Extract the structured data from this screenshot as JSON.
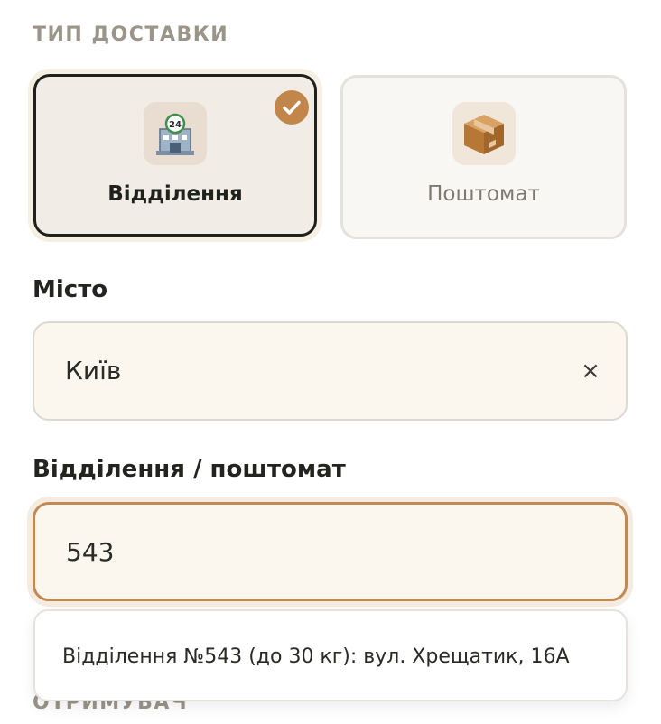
{
  "delivery_type": {
    "section_label": "ТИП ДОСТАВКИ",
    "options": [
      {
        "label": "Відділення",
        "icon": "post-office-icon",
        "selected": true
      },
      {
        "label": "Поштомат",
        "icon": "package-box-icon",
        "selected": false
      }
    ]
  },
  "city": {
    "label": "Місто",
    "value": "Київ",
    "clear_icon": "×"
  },
  "branch": {
    "label": "Відділення / поштомат",
    "value": "543"
  },
  "suggestions": [
    "Відділення №543 (до 30 кг): вул. Хрещатик, 16А"
  ],
  "recipient": {
    "section_label": "ОТРИМУВАЧ"
  },
  "colors": {
    "accent": "#c2864a",
    "selected_border": "#1f211c",
    "field_background": "#fbf7ef"
  }
}
